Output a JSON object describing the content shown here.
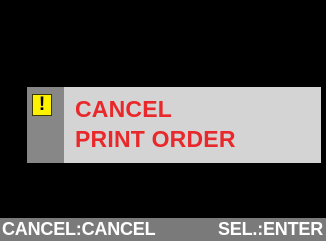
{
  "dialog": {
    "icon": "warning-exclamation-icon",
    "icon_glyph": "!",
    "message_lines": [
      "CANCEL",
      "PRINT ORDER"
    ]
  },
  "footer": {
    "left_hint": "CANCEL:CANCEL",
    "right_hint": "SEL.:ENTER"
  },
  "colors": {
    "background": "#000000",
    "dialog_background": "#d4d4d4",
    "icon_strip": "#878787",
    "warning_icon": "#fff200",
    "message_text": "#e8282a",
    "footer_background": "#7a7a7a",
    "footer_text": "#ffffff"
  }
}
